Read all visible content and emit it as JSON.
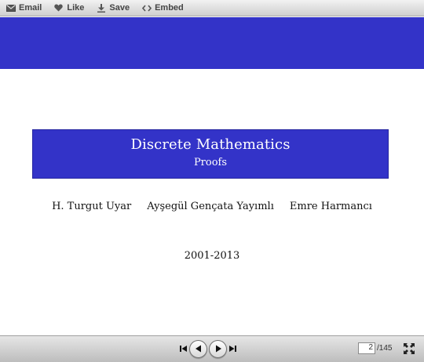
{
  "toolbar": {
    "email_label": "Email",
    "like_label": "Like",
    "save_label": "Save",
    "embed_label": "Embed",
    "icons": [
      "envelope-icon",
      "heart-icon",
      "download-icon",
      "code-icon"
    ]
  },
  "slide": {
    "title": "Discrete Mathematics",
    "subtitle": "Proofs",
    "authors": [
      "H. Turgut Uyar",
      "Ayşegül Gençata Yayımlı",
      "Emre Harmancı"
    ],
    "date": "2001-2013",
    "accent_color": "#3333c8"
  },
  "nav": {
    "current_page": "2",
    "total_pages": "/145",
    "icons": [
      "first-page-icon",
      "previous-page-icon",
      "next-page-icon",
      "last-page-icon",
      "fullscreen-icon"
    ]
  }
}
